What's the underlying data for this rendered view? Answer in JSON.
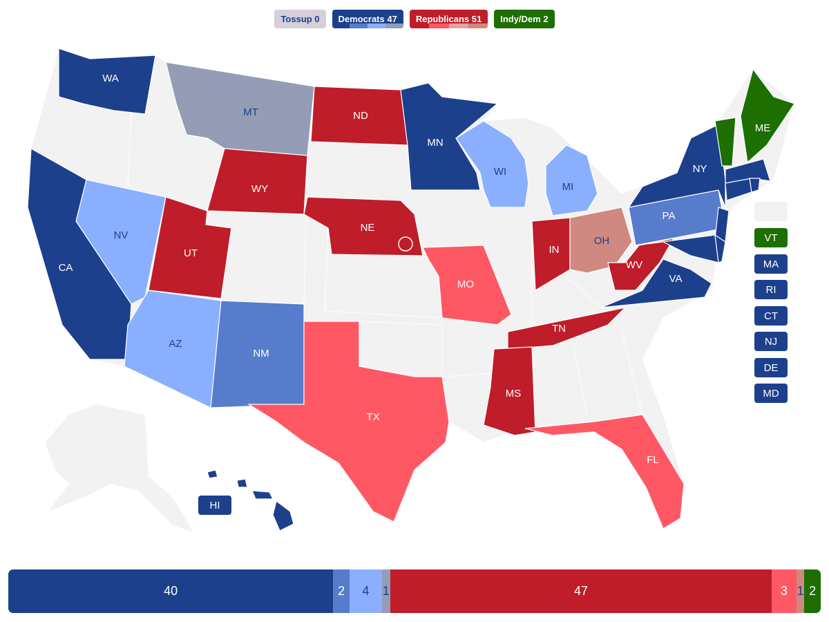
{
  "colors": {
    "safe_d": "#1c408c",
    "likely_d": "#577ccc",
    "lean_d": "#8aafff",
    "tilt_d": "#949db5",
    "safe_r": "#bf1d29",
    "likely_r": "#ff5865",
    "lean_r": "#e2a0a0",
    "tilt_r": "#cf8980",
    "indy": "#1c6f00",
    "tossup": "#d6cfd9",
    "none": "#f2f2f2"
  },
  "legend": [
    {
      "label": "Tossup 0",
      "color": "#d6cfd9",
      "text_color": "#1c408c"
    },
    {
      "label": "Democrats 47",
      "color": "#1c408c",
      "text_color": "#ffffff",
      "sub": [
        "#1c408c",
        "#577ccc",
        "#8aafff",
        "#949db5"
      ]
    },
    {
      "label": "Republicans 51",
      "color": "#bf1d29",
      "text_color": "#ffffff",
      "sub": [
        "#bf1d29",
        "#ff5865",
        "#e8a0a0",
        "#cf8980"
      ]
    },
    {
      "label": "Indy/Dem 2",
      "color": "#1c6f00",
      "text_color": "#ffffff"
    }
  ],
  "states": {
    "WA": {
      "label": "WA",
      "rating": "safe_d"
    },
    "MT": {
      "label": "MT",
      "rating": "tilt_d"
    },
    "ND": {
      "label": "ND",
      "rating": "safe_r"
    },
    "MN": {
      "label": "MN",
      "rating": "safe_d"
    },
    "WI": {
      "label": "WI",
      "rating": "lean_d"
    },
    "MI": {
      "label": "MI",
      "rating": "lean_d"
    },
    "WY": {
      "label": "WY",
      "rating": "safe_r"
    },
    "NE": {
      "label": "NE",
      "rating": "safe_r"
    },
    "NV": {
      "label": "NV",
      "rating": "lean_d"
    },
    "CA": {
      "label": "CA",
      "rating": "safe_d"
    },
    "UT": {
      "label": "UT",
      "rating": "safe_r"
    },
    "AZ": {
      "label": "AZ",
      "rating": "lean_d"
    },
    "NM": {
      "label": "NM",
      "rating": "likely_d"
    },
    "TX": {
      "label": "TX",
      "rating": "likely_r"
    },
    "MO": {
      "label": "MO",
      "rating": "likely_r"
    },
    "IN": {
      "label": "IN",
      "rating": "safe_r"
    },
    "OH": {
      "label": "OH",
      "rating": "tilt_r"
    },
    "WV": {
      "label": "WV",
      "rating": "safe_r"
    },
    "VA": {
      "label": "VA",
      "rating": "safe_d"
    },
    "TN": {
      "label": "TN",
      "rating": "safe_r"
    },
    "MS": {
      "label": "MS",
      "rating": "safe_r"
    },
    "FL": {
      "label": "FL",
      "rating": "likely_r"
    },
    "PA": {
      "label": "PA",
      "rating": "likely_d"
    },
    "NY": {
      "label": "NY",
      "rating": "safe_d"
    },
    "ME": {
      "label": "ME",
      "rating": "indy"
    },
    "HI": {
      "label": "HI",
      "rating": "safe_d"
    },
    "VT": {
      "label": "VT",
      "rating": "indy"
    },
    "MA": {
      "label": "MA",
      "rating": "safe_d"
    },
    "RI": {
      "label": "RI",
      "rating": "safe_d"
    },
    "CT": {
      "label": "CT",
      "rating": "safe_d"
    },
    "NJ": {
      "label": "NJ",
      "rating": "safe_d"
    },
    "DE": {
      "label": "DE",
      "rating": "safe_d"
    },
    "MD": {
      "label": "MD",
      "rating": "safe_d"
    }
  },
  "seat_bar": [
    {
      "value": 40,
      "rating": "safe_d"
    },
    {
      "value": 2,
      "rating": "likely_d"
    },
    {
      "value": 4,
      "rating": "lean_d"
    },
    {
      "value": 1,
      "rating": "tilt_d"
    },
    {
      "value": 47,
      "rating": "safe_r"
    },
    {
      "value": 3,
      "rating": "likely_r"
    },
    {
      "value": 1,
      "rating": "tilt_r"
    },
    {
      "value": 2,
      "rating": "indy"
    }
  ]
}
